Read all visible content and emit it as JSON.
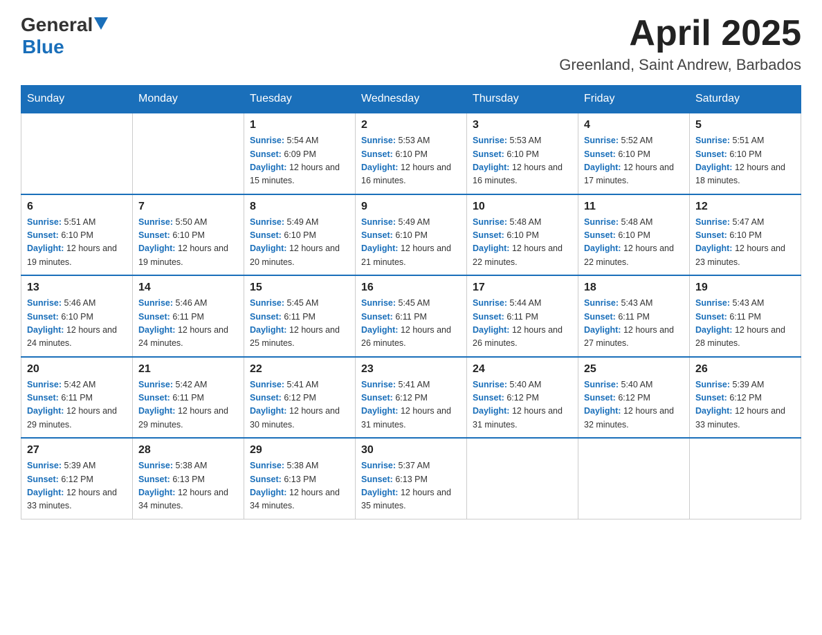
{
  "header": {
    "logo_general": "General",
    "logo_blue": "Blue",
    "month_title": "April 2025",
    "subtitle": "Greenland, Saint Andrew, Barbados"
  },
  "weekdays": [
    "Sunday",
    "Monday",
    "Tuesday",
    "Wednesday",
    "Thursday",
    "Friday",
    "Saturday"
  ],
  "weeks": [
    [
      {
        "day": "",
        "sunrise": "",
        "sunset": "",
        "daylight": ""
      },
      {
        "day": "",
        "sunrise": "",
        "sunset": "",
        "daylight": ""
      },
      {
        "day": "1",
        "sunrise": "5:54 AM",
        "sunset": "6:09 PM",
        "daylight": "12 hours and 15 minutes."
      },
      {
        "day": "2",
        "sunrise": "5:53 AM",
        "sunset": "6:10 PM",
        "daylight": "12 hours and 16 minutes."
      },
      {
        "day": "3",
        "sunrise": "5:53 AM",
        "sunset": "6:10 PM",
        "daylight": "12 hours and 16 minutes."
      },
      {
        "day": "4",
        "sunrise": "5:52 AM",
        "sunset": "6:10 PM",
        "daylight": "12 hours and 17 minutes."
      },
      {
        "day": "5",
        "sunrise": "5:51 AM",
        "sunset": "6:10 PM",
        "daylight": "12 hours and 18 minutes."
      }
    ],
    [
      {
        "day": "6",
        "sunrise": "5:51 AM",
        "sunset": "6:10 PM",
        "daylight": "12 hours and 19 minutes."
      },
      {
        "day": "7",
        "sunrise": "5:50 AM",
        "sunset": "6:10 PM",
        "daylight": "12 hours and 19 minutes."
      },
      {
        "day": "8",
        "sunrise": "5:49 AM",
        "sunset": "6:10 PM",
        "daylight": "12 hours and 20 minutes."
      },
      {
        "day": "9",
        "sunrise": "5:49 AM",
        "sunset": "6:10 PM",
        "daylight": "12 hours and 21 minutes."
      },
      {
        "day": "10",
        "sunrise": "5:48 AM",
        "sunset": "6:10 PM",
        "daylight": "12 hours and 22 minutes."
      },
      {
        "day": "11",
        "sunrise": "5:48 AM",
        "sunset": "6:10 PM",
        "daylight": "12 hours and 22 minutes."
      },
      {
        "day": "12",
        "sunrise": "5:47 AM",
        "sunset": "6:10 PM",
        "daylight": "12 hours and 23 minutes."
      }
    ],
    [
      {
        "day": "13",
        "sunrise": "5:46 AM",
        "sunset": "6:10 PM",
        "daylight": "12 hours and 24 minutes."
      },
      {
        "day": "14",
        "sunrise": "5:46 AM",
        "sunset": "6:11 PM",
        "daylight": "12 hours and 24 minutes."
      },
      {
        "day": "15",
        "sunrise": "5:45 AM",
        "sunset": "6:11 PM",
        "daylight": "12 hours and 25 minutes."
      },
      {
        "day": "16",
        "sunrise": "5:45 AM",
        "sunset": "6:11 PM",
        "daylight": "12 hours and 26 minutes."
      },
      {
        "day": "17",
        "sunrise": "5:44 AM",
        "sunset": "6:11 PM",
        "daylight": "12 hours and 26 minutes."
      },
      {
        "day": "18",
        "sunrise": "5:43 AM",
        "sunset": "6:11 PM",
        "daylight": "12 hours and 27 minutes."
      },
      {
        "day": "19",
        "sunrise": "5:43 AM",
        "sunset": "6:11 PM",
        "daylight": "12 hours and 28 minutes."
      }
    ],
    [
      {
        "day": "20",
        "sunrise": "5:42 AM",
        "sunset": "6:11 PM",
        "daylight": "12 hours and 29 minutes."
      },
      {
        "day": "21",
        "sunrise": "5:42 AM",
        "sunset": "6:11 PM",
        "daylight": "12 hours and 29 minutes."
      },
      {
        "day": "22",
        "sunrise": "5:41 AM",
        "sunset": "6:12 PM",
        "daylight": "12 hours and 30 minutes."
      },
      {
        "day": "23",
        "sunrise": "5:41 AM",
        "sunset": "6:12 PM",
        "daylight": "12 hours and 31 minutes."
      },
      {
        "day": "24",
        "sunrise": "5:40 AM",
        "sunset": "6:12 PM",
        "daylight": "12 hours and 31 minutes."
      },
      {
        "day": "25",
        "sunrise": "5:40 AM",
        "sunset": "6:12 PM",
        "daylight": "12 hours and 32 minutes."
      },
      {
        "day": "26",
        "sunrise": "5:39 AM",
        "sunset": "6:12 PM",
        "daylight": "12 hours and 33 minutes."
      }
    ],
    [
      {
        "day": "27",
        "sunrise": "5:39 AM",
        "sunset": "6:12 PM",
        "daylight": "12 hours and 33 minutes."
      },
      {
        "day": "28",
        "sunrise": "5:38 AM",
        "sunset": "6:13 PM",
        "daylight": "12 hours and 34 minutes."
      },
      {
        "day": "29",
        "sunrise": "5:38 AM",
        "sunset": "6:13 PM",
        "daylight": "12 hours and 34 minutes."
      },
      {
        "day": "30",
        "sunrise": "5:37 AM",
        "sunset": "6:13 PM",
        "daylight": "12 hours and 35 minutes."
      },
      {
        "day": "",
        "sunrise": "",
        "sunset": "",
        "daylight": ""
      },
      {
        "day": "",
        "sunrise": "",
        "sunset": "",
        "daylight": ""
      },
      {
        "day": "",
        "sunrise": "",
        "sunset": "",
        "daylight": ""
      }
    ]
  ],
  "labels": {
    "sunrise": "Sunrise:",
    "sunset": "Sunset:",
    "daylight": "Daylight:"
  }
}
